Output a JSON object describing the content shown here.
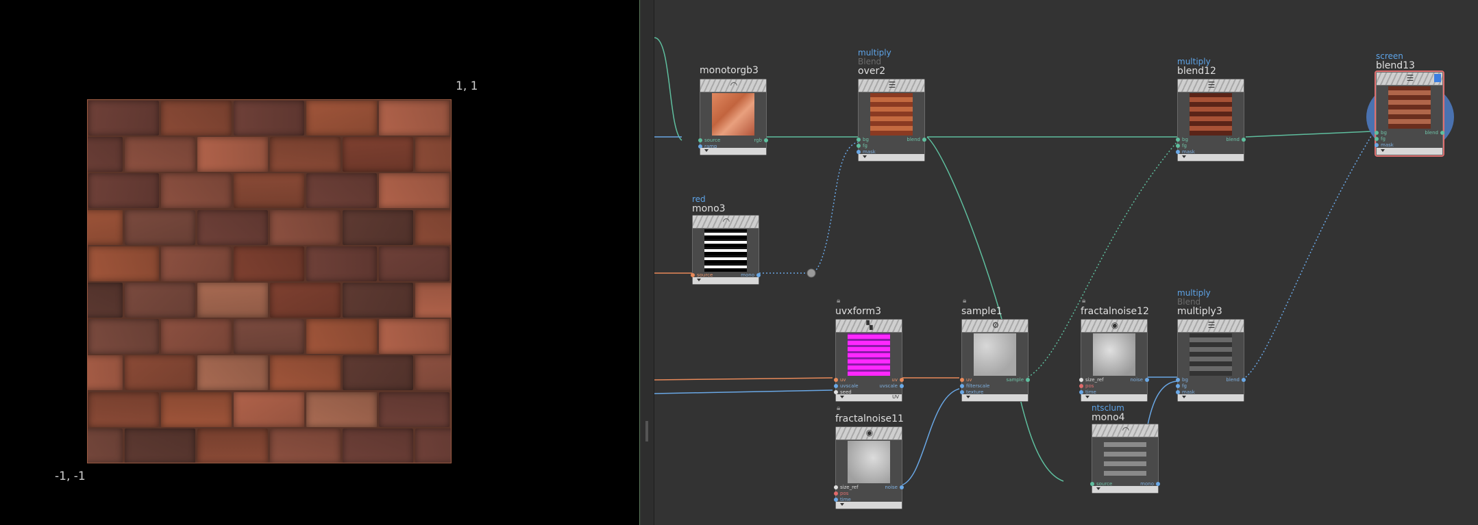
{
  "viewport": {
    "label_top_right": "1, 1",
    "label_bottom_left": "-1, -1"
  },
  "nodes": {
    "monotorgb3": {
      "name": "monotorgb3",
      "icon": "rainbow-icon",
      "inputs": [
        "source",
        "ramp"
      ],
      "outputs": [
        "rgb"
      ]
    },
    "over2": {
      "type": "multiply",
      "sub": "Blend",
      "name": "over2",
      "icon": "layers-icon",
      "inputs": [
        "bg",
        "fg",
        "mask"
      ],
      "outputs": [
        "blend"
      ]
    },
    "blend12": {
      "type": "multiply",
      "name": "blend12",
      "icon": "layers-icon",
      "inputs": [
        "bg",
        "fg",
        "mask"
      ],
      "outputs": [
        "blend"
      ]
    },
    "blend13": {
      "type": "screen",
      "name": "blend13",
      "icon": "layers-icon",
      "inputs": [
        "bg",
        "fg",
        "mask"
      ],
      "outputs": [
        "blend"
      ]
    },
    "mono3": {
      "type": "red",
      "name": "mono3",
      "icon": "rainbow-icon",
      "inputs": [
        "source"
      ],
      "outputs": [
        "mono"
      ]
    },
    "uvxform3": {
      "name": "uvxform3",
      "icon": "checker-icon",
      "inputs": [
        "uv",
        "uvscale",
        "seed"
      ],
      "outputs": [
        "uv",
        "uvscale"
      ],
      "footer": "UV"
    },
    "sample1": {
      "name": "sample1",
      "icon": "sample-icon",
      "inputs": [
        "uv",
        "filterscale",
        "texture"
      ],
      "outputs": [
        "sample"
      ]
    },
    "fractalnoise12": {
      "name": "fractalnoise12",
      "icon": "noise-icon",
      "inputs": [
        "size_ref",
        "pos",
        "time"
      ],
      "outputs": [
        "noise"
      ]
    },
    "multiply3": {
      "type": "multiply",
      "sub": "Blend",
      "name": "multiply3",
      "icon": "layers-icon",
      "inputs": [
        "bg",
        "fg",
        "mask"
      ],
      "outputs": [
        "blend"
      ]
    },
    "fractalnoise11": {
      "name": "fractalnoise11",
      "icon": "noise-icon",
      "inputs": [
        "size_ref",
        "pos",
        "time"
      ],
      "outputs": [
        "noise"
      ]
    },
    "mono4": {
      "type": "ntsclum",
      "name": "mono4",
      "icon": "rainbow-icon",
      "inputs": [
        "source"
      ],
      "outputs": [
        "mono"
      ]
    }
  },
  "colors": {
    "rgb_wire": "#5fbf9f",
    "mono_wire": "#6aa8e6",
    "uv_wire": "#e98a5a",
    "accent_type": "#5ea4e8",
    "selected_outline": "#e07070"
  }
}
